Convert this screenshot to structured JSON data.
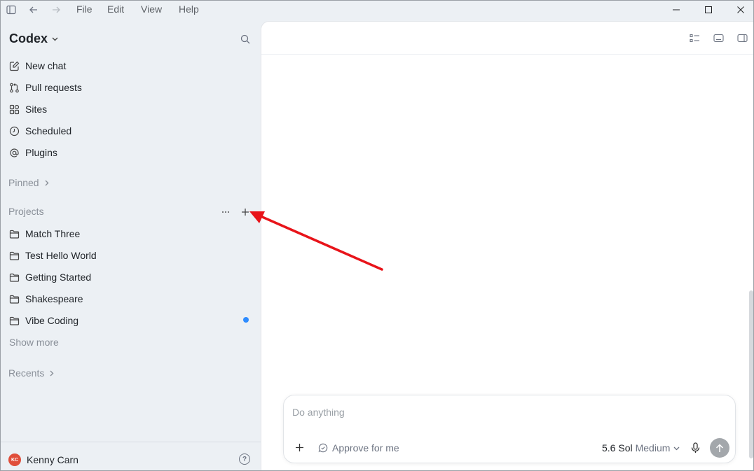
{
  "menu": [
    "File",
    "Edit",
    "View",
    "Help"
  ],
  "sidebar": {
    "app_title": "Codex",
    "nav": [
      {
        "label": "New chat",
        "icon": "edit-icon"
      },
      {
        "label": "Pull requests",
        "icon": "pull-request-icon"
      },
      {
        "label": "Sites",
        "icon": "grid-icon"
      },
      {
        "label": "Scheduled",
        "icon": "clock-icon"
      },
      {
        "label": "Plugins",
        "icon": "at-icon"
      }
    ],
    "pinned_label": "Pinned",
    "projects_label": "Projects",
    "projects": [
      "Match Three",
      "Test Hello World",
      "Getting Started",
      "Shakespeare",
      "Vibe Coding"
    ],
    "show_more": "Show more",
    "recents_label": "Recents",
    "user": {
      "initials": "KC",
      "name": "Kenny Carn"
    },
    "help_glyph": "?"
  },
  "composer": {
    "placeholder": "Do anything",
    "approve_label": "Approve for me",
    "model_name": "5.6 Sol",
    "model_level": "Medium"
  },
  "colors": {
    "accent_dot": "#2f8cff",
    "annotation_arrow": "#e8141a",
    "avatar_bg": "#e04e3a"
  }
}
